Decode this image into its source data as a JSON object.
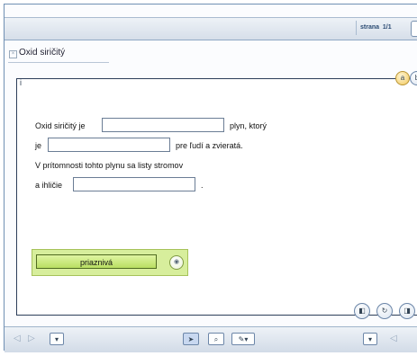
{
  "header": {
    "page_label": "strana",
    "page_number": "1/1"
  },
  "tab": {
    "title": "Oxid siričitý",
    "close_icon": "close-icon"
  },
  "panel": {
    "info_marker": "i",
    "corner_buttons": [
      "a",
      "b"
    ]
  },
  "exercise": {
    "line1_prefix": "Oxid siričitý je",
    "line1_suffix": "plyn, ktorý",
    "line2_prefix": "je",
    "line2_suffix": "pre ľudí a zvieratá.",
    "line3": "V prítomnosti tohto plynu sa listy stromov",
    "line4_prefix": "a ihličie",
    "line4_suffix": "."
  },
  "answer_option": {
    "label": "priaznivá"
  },
  "toolbar": {
    "icons": [
      "prev-arrow-icon",
      "next-arrow-icon",
      "dropdown-icon",
      "pointer-icon",
      "search-icon",
      "highlighter-icon",
      "dropdown-icon"
    ]
  }
}
